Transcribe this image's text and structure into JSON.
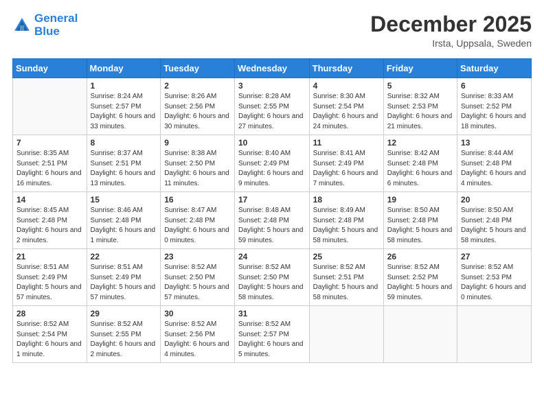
{
  "header": {
    "logo_line1": "General",
    "logo_line2": "Blue",
    "month": "December 2025",
    "location": "Irsta, Uppsala, Sweden"
  },
  "weekdays": [
    "Sunday",
    "Monday",
    "Tuesday",
    "Wednesday",
    "Thursday",
    "Friday",
    "Saturday"
  ],
  "weeks": [
    [
      {
        "day": "",
        "sunrise": "",
        "sunset": "",
        "daylight": ""
      },
      {
        "day": "1",
        "sunrise": "Sunrise: 8:24 AM",
        "sunset": "Sunset: 2:57 PM",
        "daylight": "Daylight: 6 hours and 33 minutes."
      },
      {
        "day": "2",
        "sunrise": "Sunrise: 8:26 AM",
        "sunset": "Sunset: 2:56 PM",
        "daylight": "Daylight: 6 hours and 30 minutes."
      },
      {
        "day": "3",
        "sunrise": "Sunrise: 8:28 AM",
        "sunset": "Sunset: 2:55 PM",
        "daylight": "Daylight: 6 hours and 27 minutes."
      },
      {
        "day": "4",
        "sunrise": "Sunrise: 8:30 AM",
        "sunset": "Sunset: 2:54 PM",
        "daylight": "Daylight: 6 hours and 24 minutes."
      },
      {
        "day": "5",
        "sunrise": "Sunrise: 8:32 AM",
        "sunset": "Sunset: 2:53 PM",
        "daylight": "Daylight: 6 hours and 21 minutes."
      },
      {
        "day": "6",
        "sunrise": "Sunrise: 8:33 AM",
        "sunset": "Sunset: 2:52 PM",
        "daylight": "Daylight: 6 hours and 18 minutes."
      }
    ],
    [
      {
        "day": "7",
        "sunrise": "Sunrise: 8:35 AM",
        "sunset": "Sunset: 2:51 PM",
        "daylight": "Daylight: 6 hours and 16 minutes."
      },
      {
        "day": "8",
        "sunrise": "Sunrise: 8:37 AM",
        "sunset": "Sunset: 2:51 PM",
        "daylight": "Daylight: 6 hours and 13 minutes."
      },
      {
        "day": "9",
        "sunrise": "Sunrise: 8:38 AM",
        "sunset": "Sunset: 2:50 PM",
        "daylight": "Daylight: 6 hours and 11 minutes."
      },
      {
        "day": "10",
        "sunrise": "Sunrise: 8:40 AM",
        "sunset": "Sunset: 2:49 PM",
        "daylight": "Daylight: 6 hours and 9 minutes."
      },
      {
        "day": "11",
        "sunrise": "Sunrise: 8:41 AM",
        "sunset": "Sunset: 2:49 PM",
        "daylight": "Daylight: 6 hours and 7 minutes."
      },
      {
        "day": "12",
        "sunrise": "Sunrise: 8:42 AM",
        "sunset": "Sunset: 2:48 PM",
        "daylight": "Daylight: 6 hours and 6 minutes."
      },
      {
        "day": "13",
        "sunrise": "Sunrise: 8:44 AM",
        "sunset": "Sunset: 2:48 PM",
        "daylight": "Daylight: 6 hours and 4 minutes."
      }
    ],
    [
      {
        "day": "14",
        "sunrise": "Sunrise: 8:45 AM",
        "sunset": "Sunset: 2:48 PM",
        "daylight": "Daylight: 6 hours and 2 minutes."
      },
      {
        "day": "15",
        "sunrise": "Sunrise: 8:46 AM",
        "sunset": "Sunset: 2:48 PM",
        "daylight": "Daylight: 6 hours and 1 minute."
      },
      {
        "day": "16",
        "sunrise": "Sunrise: 8:47 AM",
        "sunset": "Sunset: 2:48 PM",
        "daylight": "Daylight: 6 hours and 0 minutes."
      },
      {
        "day": "17",
        "sunrise": "Sunrise: 8:48 AM",
        "sunset": "Sunset: 2:48 PM",
        "daylight": "Daylight: 5 hours and 59 minutes."
      },
      {
        "day": "18",
        "sunrise": "Sunrise: 8:49 AM",
        "sunset": "Sunset: 2:48 PM",
        "daylight": "Daylight: 5 hours and 58 minutes."
      },
      {
        "day": "19",
        "sunrise": "Sunrise: 8:50 AM",
        "sunset": "Sunset: 2:48 PM",
        "daylight": "Daylight: 5 hours and 58 minutes."
      },
      {
        "day": "20",
        "sunrise": "Sunrise: 8:50 AM",
        "sunset": "Sunset: 2:48 PM",
        "daylight": "Daylight: 5 hours and 58 minutes."
      }
    ],
    [
      {
        "day": "21",
        "sunrise": "Sunrise: 8:51 AM",
        "sunset": "Sunset: 2:49 PM",
        "daylight": "Daylight: 5 hours and 57 minutes."
      },
      {
        "day": "22",
        "sunrise": "Sunrise: 8:51 AM",
        "sunset": "Sunset: 2:49 PM",
        "daylight": "Daylight: 5 hours and 57 minutes."
      },
      {
        "day": "23",
        "sunrise": "Sunrise: 8:52 AM",
        "sunset": "Sunset: 2:50 PM",
        "daylight": "Daylight: 5 hours and 57 minutes."
      },
      {
        "day": "24",
        "sunrise": "Sunrise: 8:52 AM",
        "sunset": "Sunset: 2:50 PM",
        "daylight": "Daylight: 5 hours and 58 minutes."
      },
      {
        "day": "25",
        "sunrise": "Sunrise: 8:52 AM",
        "sunset": "Sunset: 2:51 PM",
        "daylight": "Daylight: 5 hours and 58 minutes."
      },
      {
        "day": "26",
        "sunrise": "Sunrise: 8:52 AM",
        "sunset": "Sunset: 2:52 PM",
        "daylight": "Daylight: 5 hours and 59 minutes."
      },
      {
        "day": "27",
        "sunrise": "Sunrise: 8:52 AM",
        "sunset": "Sunset: 2:53 PM",
        "daylight": "Daylight: 6 hours and 0 minutes."
      }
    ],
    [
      {
        "day": "28",
        "sunrise": "Sunrise: 8:52 AM",
        "sunset": "Sunset: 2:54 PM",
        "daylight": "Daylight: 6 hours and 1 minute."
      },
      {
        "day": "29",
        "sunrise": "Sunrise: 8:52 AM",
        "sunset": "Sunset: 2:55 PM",
        "daylight": "Daylight: 6 hours and 2 minutes."
      },
      {
        "day": "30",
        "sunrise": "Sunrise: 8:52 AM",
        "sunset": "Sunset: 2:56 PM",
        "daylight": "Daylight: 6 hours and 4 minutes."
      },
      {
        "day": "31",
        "sunrise": "Sunrise: 8:52 AM",
        "sunset": "Sunset: 2:57 PM",
        "daylight": "Daylight: 6 hours and 5 minutes."
      },
      {
        "day": "",
        "sunrise": "",
        "sunset": "",
        "daylight": ""
      },
      {
        "day": "",
        "sunrise": "",
        "sunset": "",
        "daylight": ""
      },
      {
        "day": "",
        "sunrise": "",
        "sunset": "",
        "daylight": ""
      }
    ]
  ]
}
